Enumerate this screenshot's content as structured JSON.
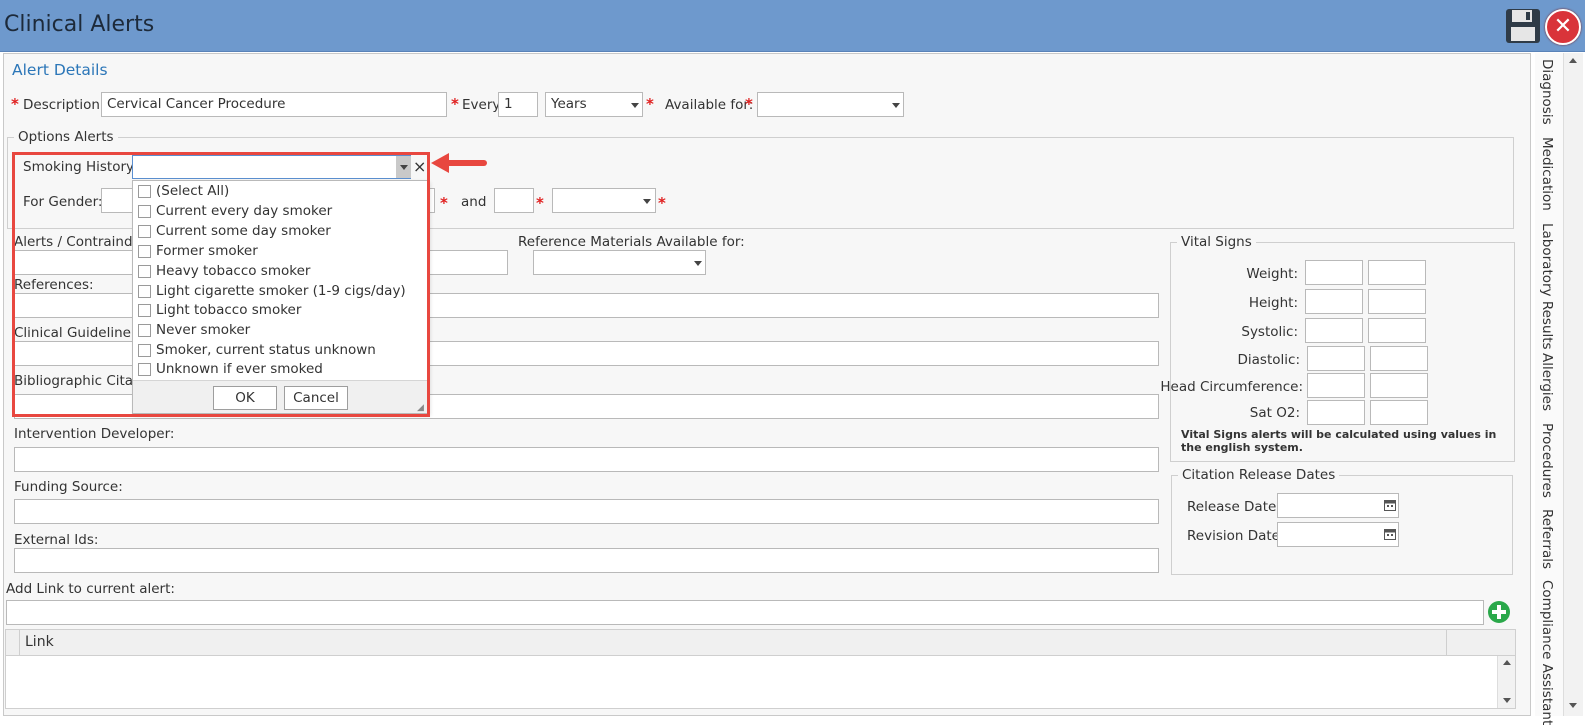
{
  "window": {
    "title": "Clinical Alerts"
  },
  "alert_details": {
    "title": "Alert Details",
    "description_label": "Description:",
    "description_value": "Cervical Cancer Procedure",
    "every_label": "Every:",
    "every_value": "1",
    "period_value": "Years",
    "available_for_label": "Available for:",
    "available_for_value": "",
    "required_mark": "*"
  },
  "options_alerts": {
    "legend": "Options Alerts",
    "smoking_history_label": "Smoking History:",
    "smoking_history_value": "",
    "clear_glyph": "×",
    "for_gender_label": "For Gender:",
    "and_label": "and"
  },
  "smoking_dropdown": {
    "options": [
      "(Select All)",
      "Current every day smoker",
      "Current some day smoker",
      "Former smoker",
      "Heavy tobacco smoker",
      "Light cigarette smoker (1-9 cigs/day)",
      "Light tobacco smoker",
      "Never smoker",
      "Smoker, current status unknown",
      "Unknown if ever smoked"
    ],
    "ok_label": "OK",
    "cancel_label": "Cancel"
  },
  "form": {
    "alerts_label": "Alerts / Contraindic",
    "reference_materials_label": "Reference Materials Available for:",
    "references_label": "References:",
    "clinical_guideline_label": "Clinical Guideline:",
    "bibliographic_label": "Bibliographic Citatio",
    "intervention_developer_label": "Intervention Developer:",
    "funding_source_label": "Funding Source:",
    "external_ids_label": "External Ids:",
    "add_link_label": "Add Link to current alert:",
    "link_column_header": "Link"
  },
  "vital_signs": {
    "legend": "Vital Signs",
    "rows": [
      "Weight:",
      "Height:",
      "Systolic:",
      "Diastolic:",
      "Head Circumference:",
      "Sat O2:"
    ],
    "note": "Vital Signs alerts will be calculated using values in the english system."
  },
  "citation_release": {
    "legend": "Citation Release Dates",
    "release_date_label": "Release Date:",
    "revision_date_label": "Revision Date:"
  },
  "side_tabs": [
    "Diagnosis",
    "Medication",
    "Laboratory Results",
    "Allergies",
    "Procedures",
    "Referrals",
    "Compliance Assistant"
  ],
  "icons": {
    "save": "floppy-disk-icon",
    "close": "close-icon",
    "add": "plus-circle-icon",
    "calendar": "calendar-icon",
    "callout": "callout-arrow"
  },
  "colors": {
    "titlebar": "#6e99cd",
    "section_title": "#2b76b8",
    "required": "#e02020",
    "highlight": "#e8473f",
    "add_button": "#2aa84a"
  }
}
